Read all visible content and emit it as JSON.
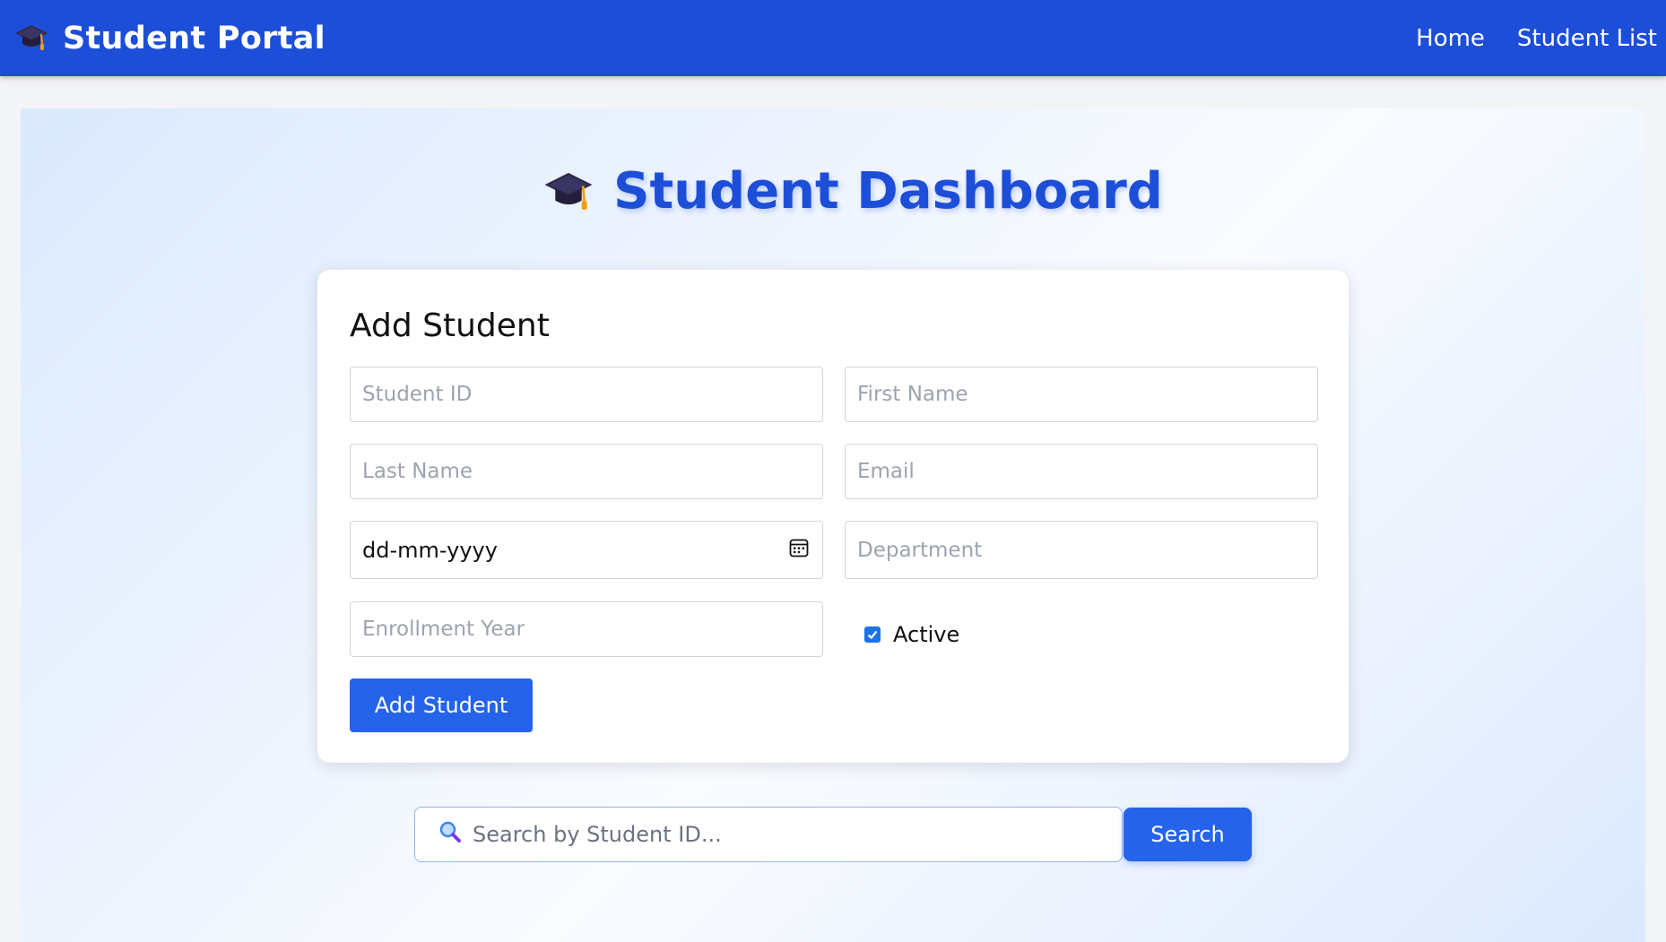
{
  "navbar": {
    "brand_icon": "graduation-cap-icon",
    "brand_title": "Student Portal",
    "links": [
      "Home",
      "Student List"
    ],
    "color": "#1d4ed8"
  },
  "dashboard": {
    "title_icon": "graduation-cap-icon",
    "title": "Student Dashboard"
  },
  "form": {
    "title": "Add Student",
    "fields": {
      "student_id": {
        "placeholder": "Student ID"
      },
      "first_name": {
        "placeholder": "First Name"
      },
      "last_name": {
        "placeholder": "Last Name"
      },
      "email": {
        "placeholder": "Email"
      },
      "dob": {
        "value": "dd-mm-yyyy",
        "icon": "calendar-icon"
      },
      "department": {
        "placeholder": "Department"
      },
      "enrollment_year": {
        "placeholder": "Enrollment Year"
      }
    },
    "active": {
      "label": "Active",
      "checked": true
    },
    "submit_label": "Add Student",
    "accent": "#2563eb"
  },
  "search": {
    "icon": "magnifier-icon",
    "placeholder": "Search by Student ID...",
    "button_label": "Search"
  }
}
